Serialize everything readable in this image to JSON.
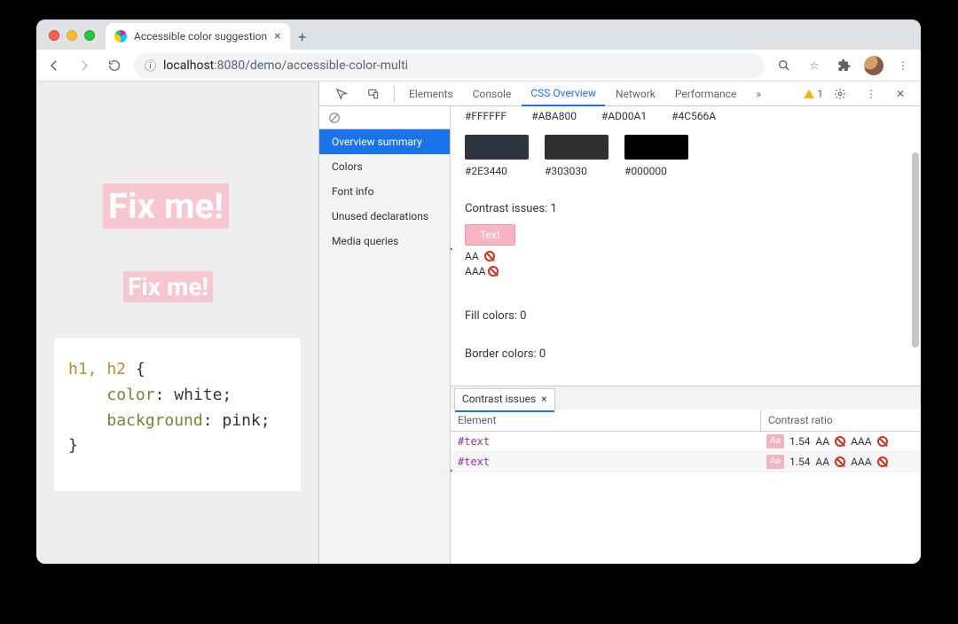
{
  "tab": {
    "title": "Accessible color suggestion"
  },
  "url": {
    "host": "localhost",
    "port": ":8080",
    "path": "/demo/accessible-color-multi"
  },
  "page": {
    "h1": "Fix me!",
    "h2": "Fix me!",
    "code": {
      "selector": "h1, h2",
      "l1_prop": "color",
      "l1_val": "white",
      "l2_prop": "background",
      "l2_val": "pink"
    }
  },
  "devtools": {
    "tabs": {
      "elements": "Elements",
      "console": "Console",
      "cssOverview": "CSS Overview",
      "network": "Network",
      "performance": "Performance"
    },
    "warningCount": "1",
    "sidebar": {
      "summary": "Overview summary",
      "colors": "Colors",
      "font": "Font info",
      "unused": "Unused declarations",
      "media": "Media queries"
    },
    "topHexes": {
      "c1": "#FFFFFF",
      "c2": "#ABA800",
      "c3": "#AD00A1",
      "c4": "#4C566A"
    },
    "swatches": [
      {
        "hex": "#2E3440"
      },
      {
        "hex": "#303030"
      },
      {
        "hex": "#000000"
      }
    ],
    "contrastHeading": "Contrast issues: 1",
    "textPill": "Text",
    "aa": "AA",
    "aaa": "AAA",
    "fillHeading": "Fill colors: 0",
    "borderHeading": "Border colors: 0",
    "panel": {
      "tabLabel": "Contrast issues",
      "colElement": "Element",
      "colRatio": "Contrast ratio",
      "rows": [
        {
          "el": "#text",
          "ratio": "1.54",
          "aa": "AA",
          "aaa": "AAA"
        },
        {
          "el": "#text",
          "ratio": "1.54",
          "aa": "AA",
          "aaa": "AAA"
        }
      ]
    }
  }
}
